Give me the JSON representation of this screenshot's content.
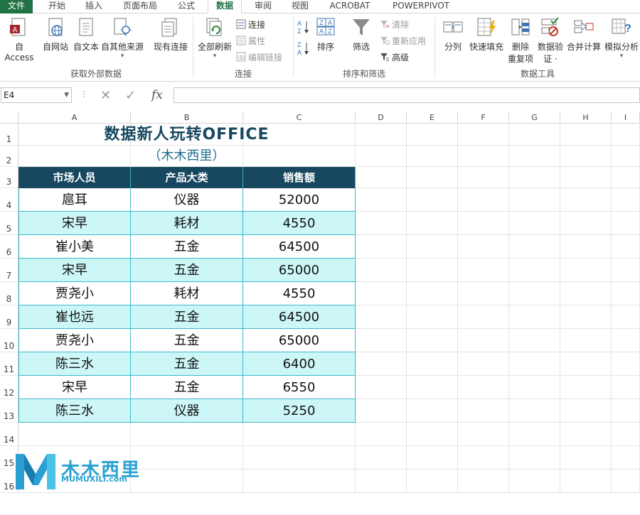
{
  "ribbon_tabs": [
    "文件",
    "开始",
    "插入",
    "页面布局",
    "公式",
    "数据",
    "审阅",
    "视图",
    "ACROBAT",
    "POWERPIVOT"
  ],
  "active_tab": "数据",
  "groups": {
    "external": {
      "label": "获取外部数据",
      "buttons": [
        "自 Access",
        "自网站",
        "自文本",
        "自其他来源",
        "现有连接"
      ]
    },
    "connections": {
      "label": "连接",
      "refresh": "全部刷新",
      "small": [
        "连接",
        "属性",
        "编辑链接"
      ]
    },
    "sort_filter": {
      "label": "排序和筛选",
      "sort": "排序",
      "filter": "筛选",
      "small": [
        "清除",
        "重新应用",
        "高级"
      ]
    },
    "data_tools": {
      "label": "数据工具",
      "split": "分列",
      "flash_fill": "快速填充",
      "remove_dup_1": "删除",
      "remove_dup_2": "重复项",
      "validation_1": "数据验",
      "validation_2": "证 ·",
      "consolidate": "合并计算",
      "whatif": "模拟分析"
    }
  },
  "formula_bar": {
    "name_box": "E4",
    "fx": "fx",
    "content": ""
  },
  "columns": [
    "A",
    "B",
    "C",
    "D",
    "E",
    "F",
    "G",
    "H",
    "I"
  ],
  "rows": [
    "1",
    "2",
    "3",
    "4",
    "5",
    "6",
    "7",
    "8",
    "9",
    "10",
    "11",
    "12",
    "13",
    "14",
    "15",
    "16"
  ],
  "sheet": {
    "title": "数据新人玩转OFFICE",
    "subtitle": "（木木西里）",
    "headers": [
      "市场人员",
      "产品大类",
      "销售额"
    ],
    "records": [
      [
        "扈耳",
        "仪器",
        "52000"
      ],
      [
        "宋早",
        "耗材",
        "4550"
      ],
      [
        "崔小美",
        "五金",
        "64500"
      ],
      [
        "宋早",
        "五金",
        "65000"
      ],
      [
        "贾尧小",
        "耗材",
        "4550"
      ],
      [
        "崔也远",
        "五金",
        "64500"
      ],
      [
        "贾尧小",
        "五金",
        "65000"
      ],
      [
        "陈三水",
        "五金",
        "6400"
      ],
      [
        "宋早",
        "五金",
        "6550"
      ],
      [
        "陈三水",
        "仪器",
        "5250"
      ]
    ]
  },
  "watermark": {
    "text": "木木西里",
    "sub": "MUMUXILi.com"
  },
  "colors": {
    "excel_green": "#217346",
    "header_fill": "#17485f",
    "band_fill": "#cdf6f7",
    "border": "#3cb8cc"
  }
}
